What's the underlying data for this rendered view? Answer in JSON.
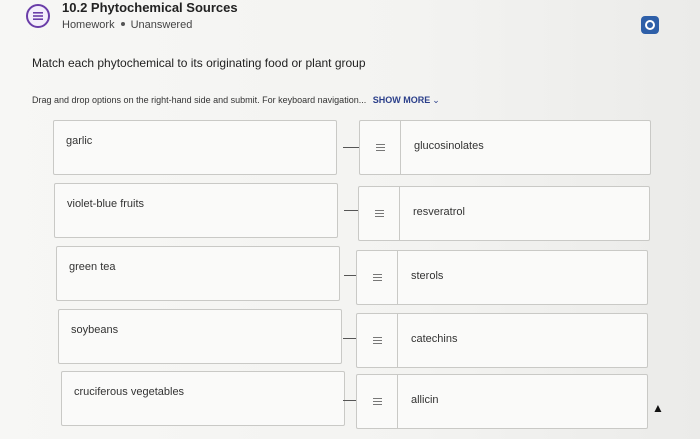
{
  "header": {
    "title": "10.2 Phytochemical Sources",
    "category": "Homework",
    "status": "Unanswered",
    "icon": "assignment-list-icon"
  },
  "question": {
    "prompt": "Match each phytochemical to its originating food or plant group",
    "instructions": "Drag and drop options on the right-hand side and submit. For keyboard navigation...",
    "show_more": "SHOW MORE"
  },
  "pairs": [
    {
      "left": "garlic",
      "right": "glucosinolates"
    },
    {
      "left": "violet-blue fruits",
      "right": "resveratrol"
    },
    {
      "left": "green tea",
      "right": "sterols"
    },
    {
      "left": "soybeans",
      "right": "catechins"
    },
    {
      "left": "cruciferous vegetables",
      "right": "allicin"
    }
  ],
  "colors": {
    "accent_purple": "#6a3da8",
    "button_blue": "#2e5fa8",
    "link_blue": "#2b3f8a"
  }
}
